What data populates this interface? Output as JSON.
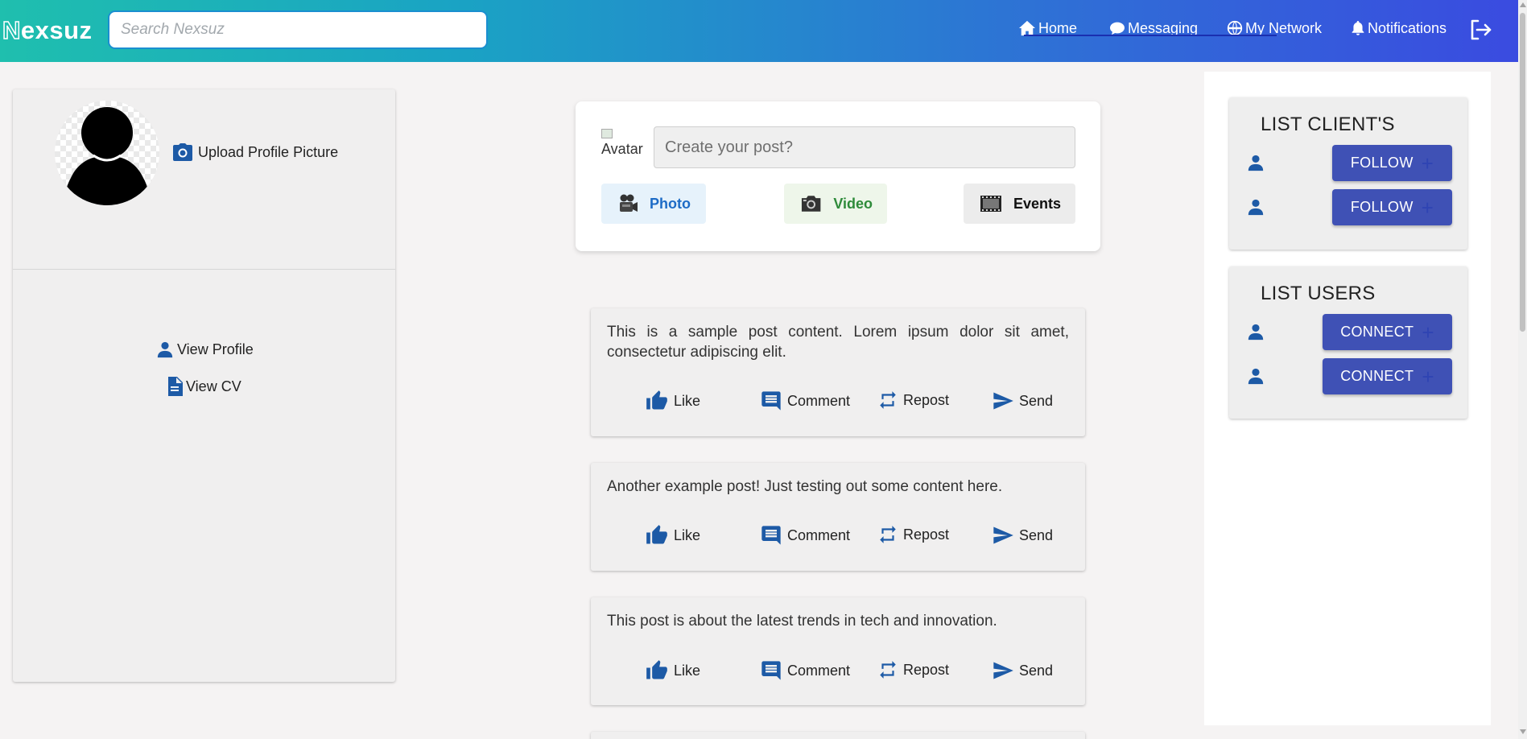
{
  "header": {
    "logo_first": "N",
    "logo_rest": "exsuz",
    "search_placeholder": "Search Nexsuz",
    "nav": {
      "home": "Home",
      "messaging": "Messaging",
      "network": "My Network",
      "notifications": "Notifications"
    }
  },
  "profile": {
    "upload_label": "Upload Profile Picture",
    "view_profile": "View Profile",
    "view_cv": "View CV"
  },
  "composer": {
    "avatar_alt": "Avatar",
    "placeholder": "Create your post?",
    "photo": "Photo",
    "video": "Video",
    "events": "Events"
  },
  "posts": [
    {
      "text": "This is a sample post content. Lorem ipsum dolor sit amet, consectetur adipiscing elit."
    },
    {
      "text": "Another example post! Just testing out some content here."
    },
    {
      "text": "This post is about the latest trends in tech and innovation."
    }
  ],
  "actions": {
    "like": "Like",
    "comment": "Comment",
    "repost": "Repost",
    "send": "Send"
  },
  "clients": {
    "title": "LIST CLIENT'S",
    "button": "FOLLOW"
  },
  "users": {
    "title": "LIST USERS",
    "button": "CONNECT"
  },
  "colors": {
    "accent": "#3f51b5",
    "icon_blue": "#1d5aa6",
    "gradient_start": "#1fbfae",
    "gradient_end": "#3a4be0"
  }
}
